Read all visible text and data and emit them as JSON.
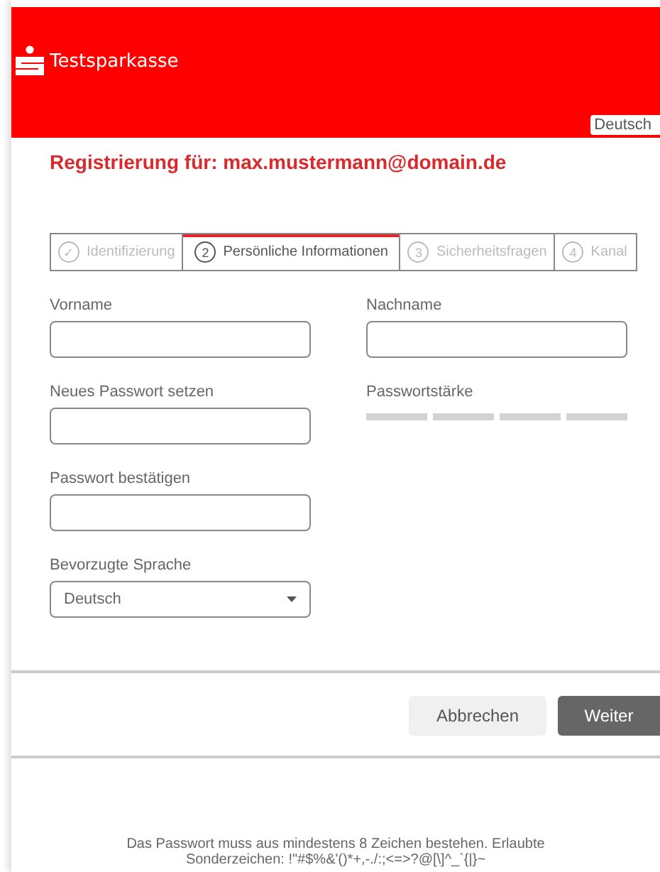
{
  "header": {
    "brand": "Testsparkasse",
    "language": "Deutsch"
  },
  "title": "Registrierung für: max.mustermann@domain.de",
  "steps": [
    {
      "number": "✓",
      "label": "Identifizierung",
      "selected": false
    },
    {
      "number": "2",
      "label": "Persönliche Informationen",
      "selected": true
    },
    {
      "number": "3",
      "label": "Sicherheitsfragen",
      "selected": false
    },
    {
      "number": "4",
      "label": "Kanal",
      "selected": false
    }
  ],
  "fields": [
    {
      "kind": "text",
      "label": "Vorname"
    },
    {
      "kind": "text",
      "label": "Nachname"
    },
    {
      "kind": "password",
      "label": "Neues Passwort setzen"
    },
    {
      "kind": "meter",
      "label": "Passwortstärke"
    },
    {
      "kind": "password",
      "label": "Passwort bestätigen"
    },
    {
      "kind": "spacer"
    },
    {
      "kind": "select",
      "label": "Bevorzugte Sprache",
      "value": "Deutsch"
    }
  ],
  "buttons": [
    {
      "label": "Abbrechen",
      "kind": "secondary"
    },
    {
      "label": "Weiter",
      "kind": "primary"
    }
  ],
  "footer_note": "Das Passwort muss aus mindestens 8 Zeichen bestehen. Erlaubte Sonderzeichen: !\"#$%&'()*+,-./:;<=>?@[\\]^_`{|}~"
}
